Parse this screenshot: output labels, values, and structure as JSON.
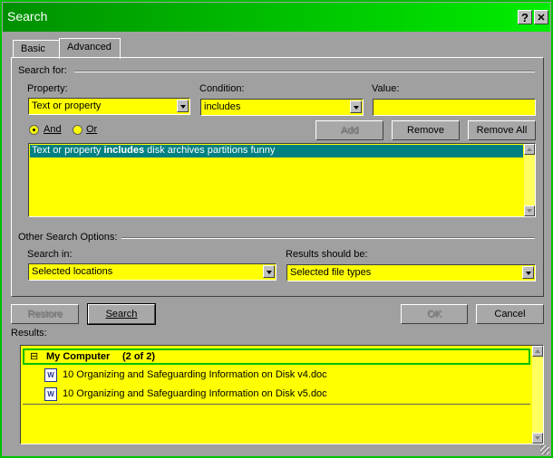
{
  "window": {
    "title": "Search"
  },
  "titlebar": {
    "help_label": "?",
    "close_label": "✕"
  },
  "tabs": [
    {
      "label": "Basic"
    },
    {
      "label": "Advanced"
    }
  ],
  "search_for": {
    "group_label": "Search for:",
    "property_label": "Property:",
    "property_value": "Text or property",
    "condition_label": "Condition:",
    "condition_value": "includes",
    "value_label": "Value:",
    "value_value": "",
    "and_label": "And",
    "or_label": "Or",
    "and_selected": true,
    "add_label": "Add",
    "remove_label": "Remove",
    "remove_all_label": "Remove All",
    "criteria": [
      {
        "prefix": "Text or property ",
        "bold": "includes",
        "suffix": " disk archives partitions funny"
      }
    ]
  },
  "other_options": {
    "group_label": "Other Search Options:",
    "search_in_label": "Search in:",
    "search_in_value": "Selected locations",
    "results_be_label": "Results should be:",
    "results_be_value": "Selected file types"
  },
  "actions": {
    "restore_label": "Restore",
    "search_label": "Search",
    "ok_label": "OK",
    "cancel_label": "Cancel"
  },
  "results": {
    "label": "Results:",
    "group_title": "My Computer",
    "group_count": "(2 of 2)",
    "expander": "⊟",
    "items": [
      {
        "name": "10 Organizing and Safeguarding Information on Disk v4.doc",
        "icon": "word-doc-icon"
      },
      {
        "name": "10 Organizing and Safeguarding Information on Disk v5.doc",
        "icon": "word-doc-icon"
      }
    ]
  },
  "colors": {
    "titlebar": "#00c000",
    "field": "#ffff00",
    "selection": "#008080",
    "dialog": "#a0a0a0"
  }
}
